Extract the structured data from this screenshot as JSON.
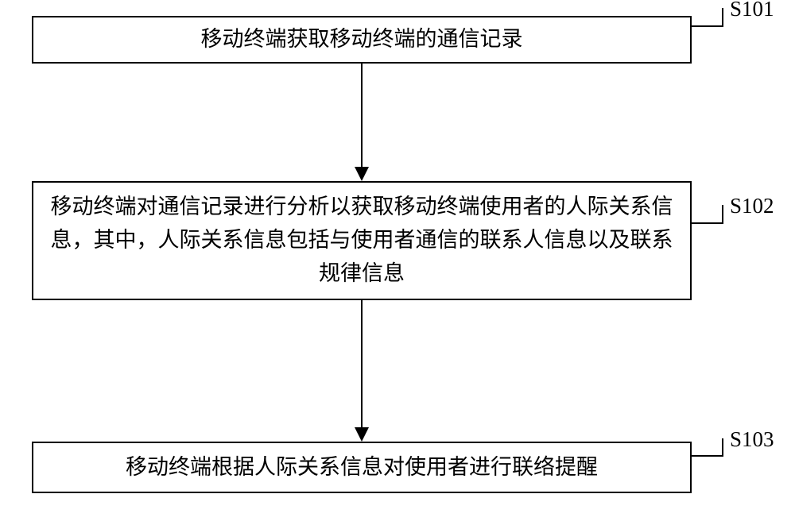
{
  "diagram": {
    "steps": [
      {
        "id": "S101",
        "text": "移动终端获取移动终端的通信记录"
      },
      {
        "id": "S102",
        "text": "移动终端对通信记录进行分析以获取移动终端使用者的人际关系信息，其中，人际关系信息包括与使用者通信的联系人信息以及联系规律信息"
      },
      {
        "id": "S103",
        "text": "移动终端根据人际关系信息对使用者进行联络提醒"
      }
    ]
  }
}
